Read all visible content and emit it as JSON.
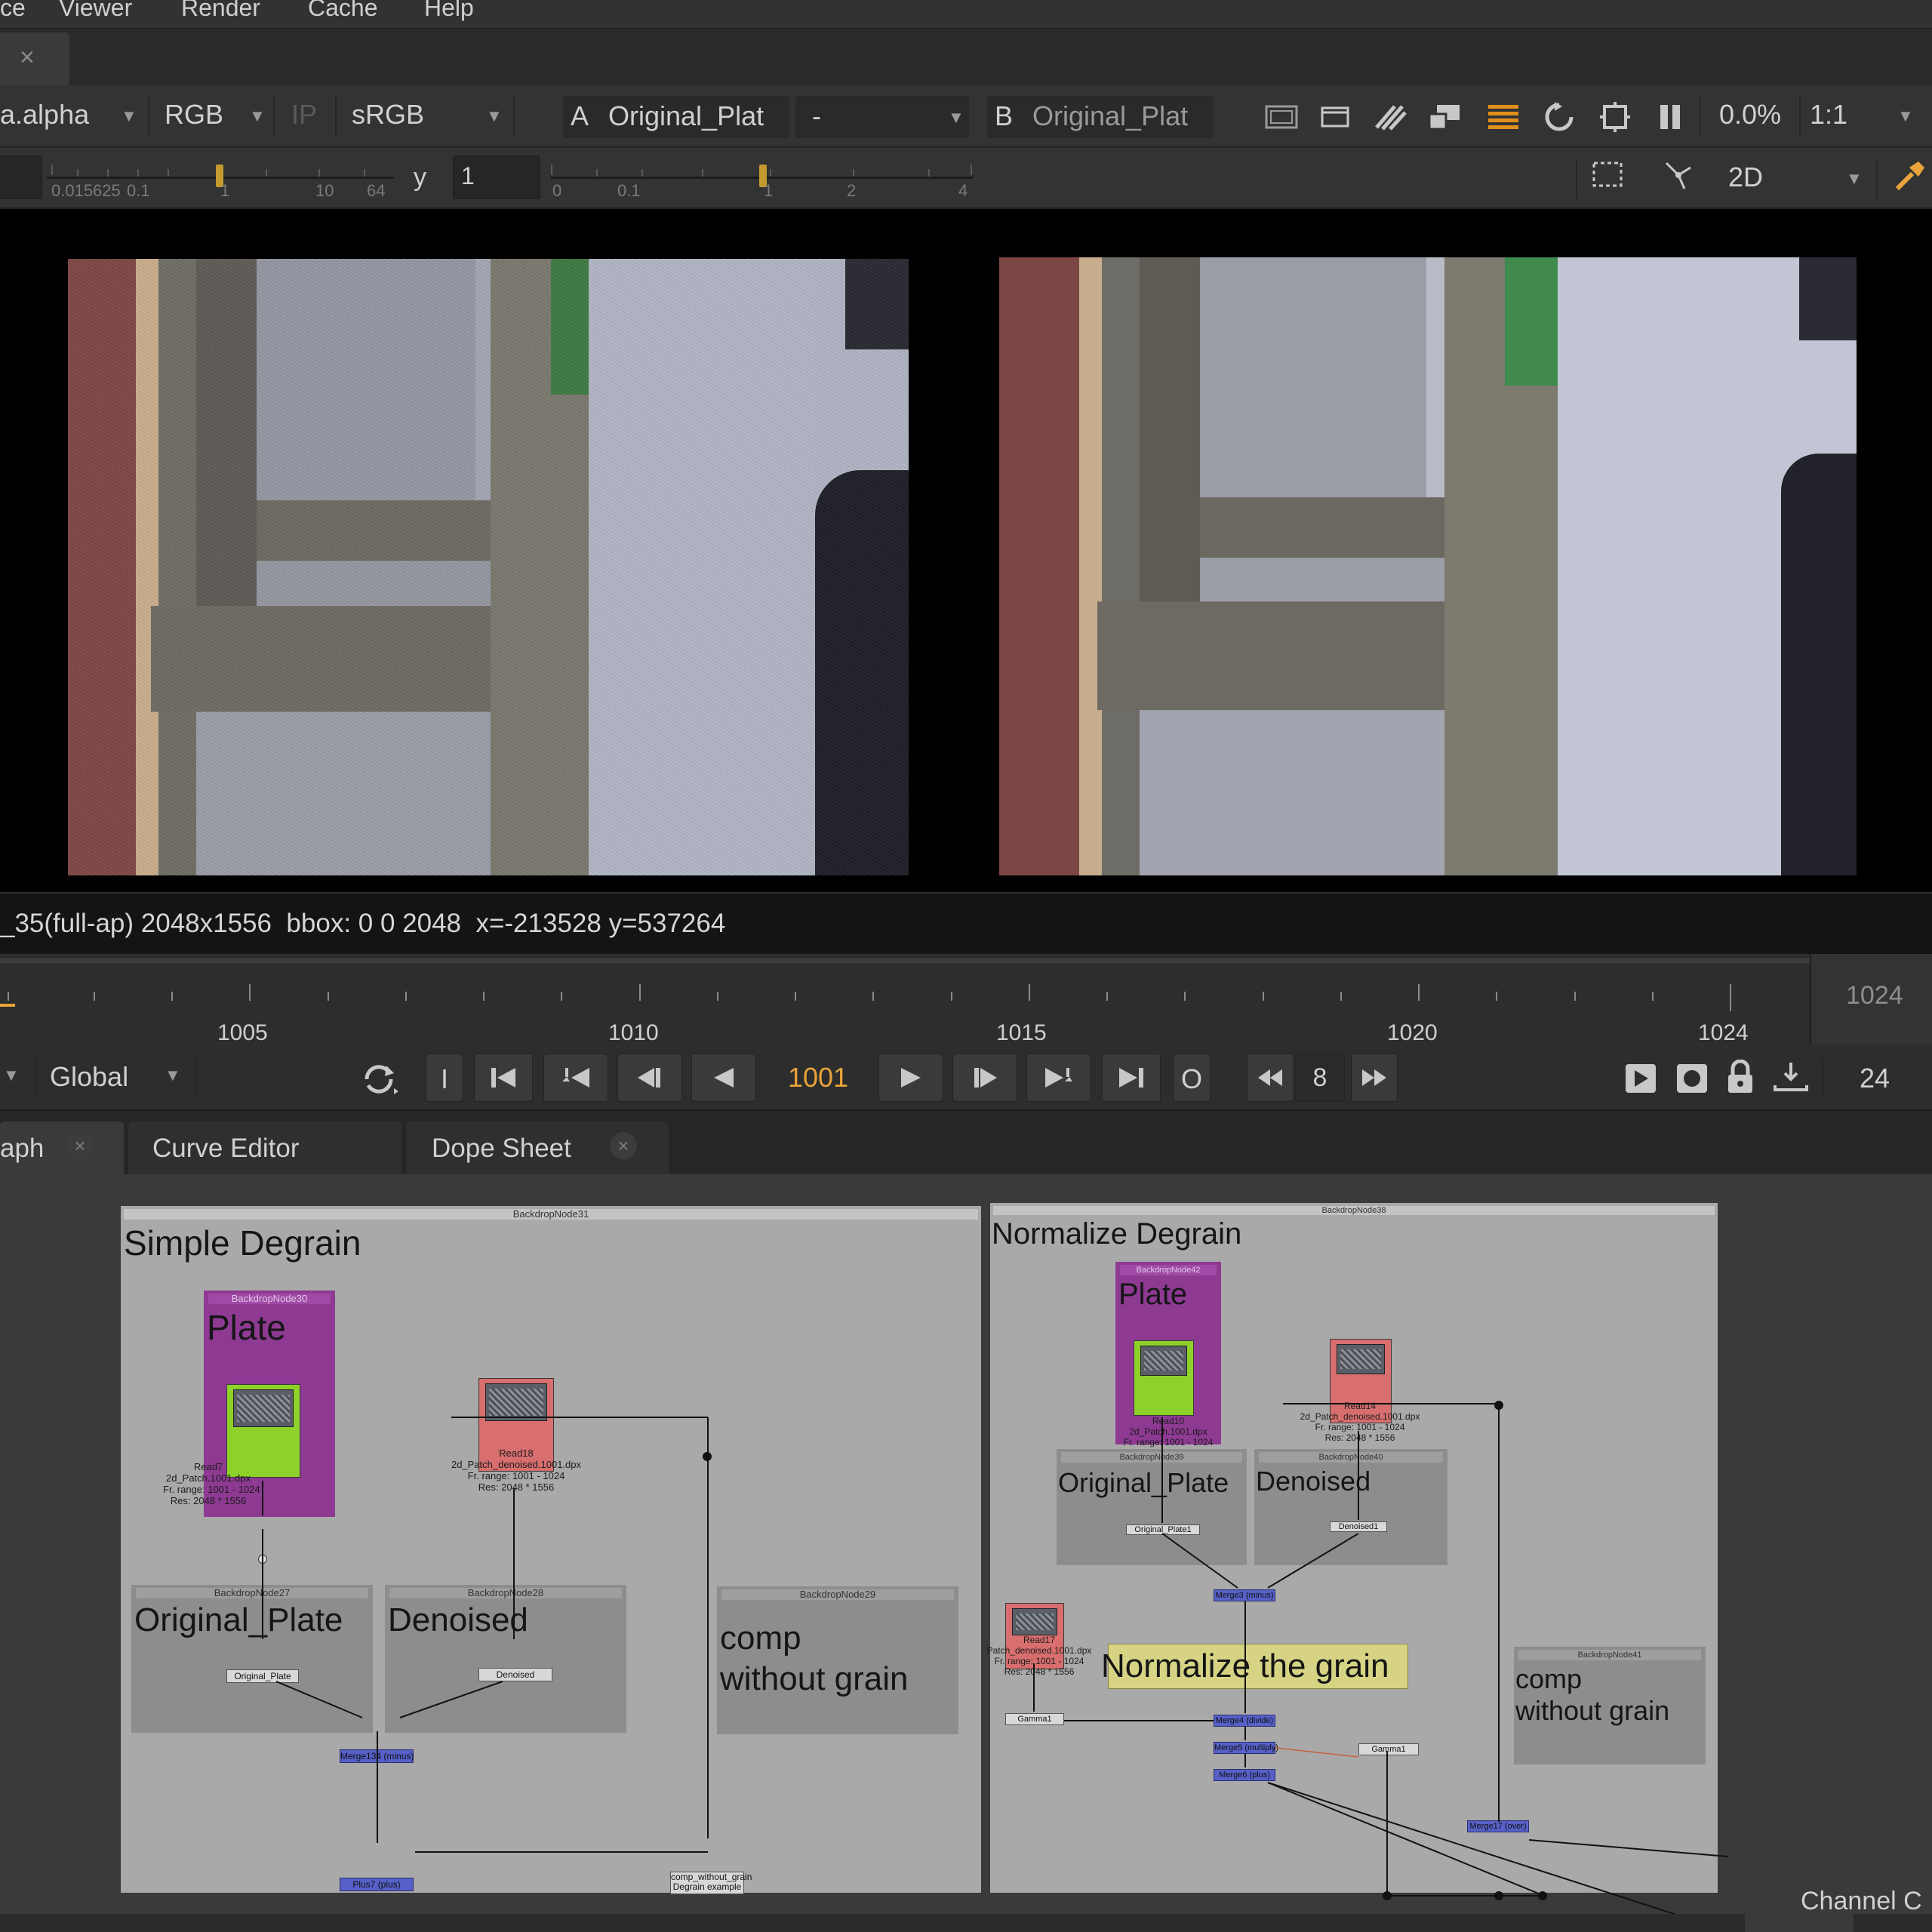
{
  "menu": [
    "ce",
    "Viewer",
    "Render",
    "Cache",
    "Help"
  ],
  "viewer_tab": {
    "close": "×"
  },
  "toolbar1": {
    "channels": "a.alpha",
    "display": "RGB",
    "ip": "IP",
    "lut": "sRGB",
    "a_label": "A",
    "a_input": "Original_Plat",
    "wipe": "-",
    "b_label": "B",
    "b_input": "Original_Plat",
    "zoom_pct": "0.0%",
    "ratio": "1:1"
  },
  "toolbar2": {
    "gain_ticks": [
      "0.015625",
      "0.1",
      "1",
      "10",
      "64"
    ],
    "gamma_label": "y",
    "gamma_value": "1",
    "gamma_ticks": [
      "0",
      "0.1",
      "1",
      "2",
      "4"
    ],
    "view_mode": "2D"
  },
  "infobar": {
    "text": "_35(full-ap) 2048x1556  bbox: 0 0 2048  x=-213528 y=537264"
  },
  "timeline": {
    "ticks": [
      "1005",
      "1010",
      "1015",
      "1020",
      "1024"
    ],
    "end_frame": "1024"
  },
  "transport": {
    "scope": "Global",
    "in_btn": "I",
    "out_btn": "O",
    "current_frame": "1001",
    "step": "8",
    "fps": "24"
  },
  "panel_tabs": [
    {
      "label": "aph"
    },
    {
      "label": "Curve Editor"
    },
    {
      "label": "Dope Sheet"
    }
  ],
  "graph": {
    "left": {
      "backdrop": "BackdropNode31",
      "title": "Simple Degrain",
      "plate_bd": "BackdropNode30",
      "plate_title": "Plate",
      "read7": "Read7\n2d_Patch.1001.dpx\nFr. range: 1001 - 1024\nRes: 2048 * 1556",
      "read18": "Read18\n2d_Patch_denoised.1001.dpx\nFr. range: 1001 - 1024\nRes: 2048 * 1556",
      "bd27": "BackdropNode27",
      "bd27_title": "Original_Plate",
      "bd28": "BackdropNode28",
      "bd28_title": "Denoised",
      "bd29": "BackdropNode29",
      "bd29_title": "comp\nwithout grain",
      "dot_orig": "Original_Plate",
      "dot_den": "Denoised",
      "merge": "Merge134 (minus)",
      "plus": "Plus7 (plus)",
      "comp_node": "comp_without_grain\nDegrain example"
    },
    "right": {
      "backdrop": "BackdropNode38",
      "title": "Normalize Degrain",
      "plate_bd": "BackdropNode42",
      "plate_title": "Plate",
      "read10": "Read10\n2d_Patch.1001.dpx\nFr. range: 1001 - 1024\nRes: 2048 * 1556",
      "read14": "Read14\n2d_Patch_denoised.1001.dpx\nFr. range: 1001 - 1024\nRes: 2048 * 1556",
      "read17": "Read17\nPatch_denoised.1001.dpx\nFr. range: 1001 - 1024\nRes: 2048 * 1556",
      "bd39": "BackdropNode39",
      "bd39_title": "Original_Plate",
      "bd40": "BackdropNode40",
      "bd40_title": "Denoised",
      "dot_orig": "Original_Plate1",
      "dot_den": "Denoised1",
      "merge_minus": "Merge3 (minus)",
      "sticky": "Normalize the grain",
      "gamma1": "Gamma1",
      "gamma2": "Gamma1",
      "merge_divide": "Merge4 (divide)",
      "merge_multiply": "Merge5 (multiply)",
      "merge_plus": "Merge6 (plus)",
      "bd41": "BackdropNode41",
      "bd41_title": "comp\nwithout grain",
      "merge17": "Merge17 (over)"
    }
  },
  "channel_label": "Channel C",
  "colors": {
    "accent": "#e8a33a",
    "merge": "#5660c8",
    "plate_backdrop": "#8e3a93",
    "read_plate": "#8ed12b",
    "read_denoised": "#d86e6e",
    "sticky": "#d6d484"
  }
}
